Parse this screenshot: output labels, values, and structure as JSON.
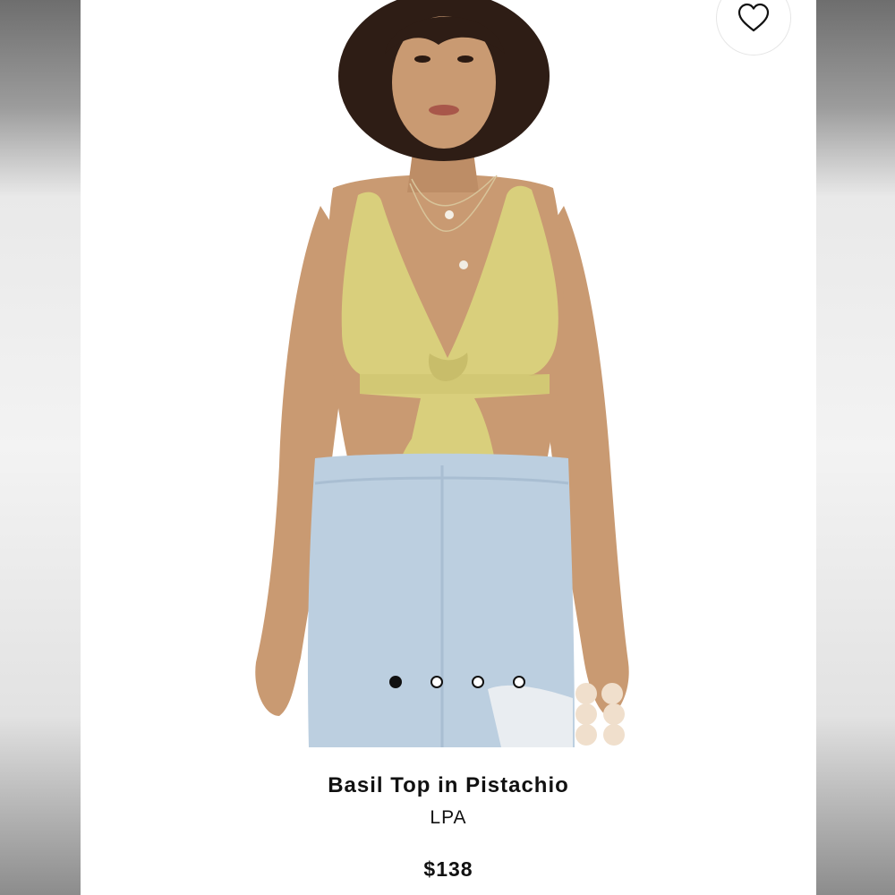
{
  "product": {
    "title": "Basil Top in Pistachio",
    "brand": "LPA",
    "price": "$138"
  },
  "carousel": {
    "total_images": 4,
    "active_index": 0
  },
  "wishlist": {
    "icon": "heart-outline-icon"
  },
  "colors": {
    "top": "#d9cf7c",
    "denim": "#bccfe0",
    "skin": "#c99a72",
    "hair": "#2e1d15"
  }
}
